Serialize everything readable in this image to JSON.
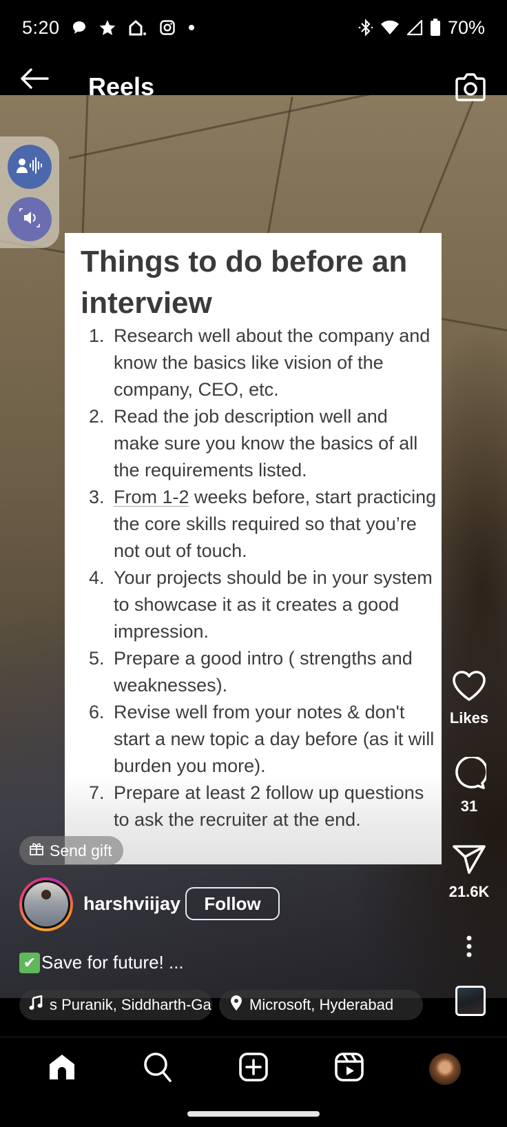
{
  "status_bar": {
    "time": "5:20",
    "left_icons": [
      "chat-bubble-icon",
      "star-icon",
      "home-alert-icon",
      "instagram-icon",
      "dot-icon"
    ],
    "right_icons": [
      "bluetooth-icon",
      "wifi-icon",
      "cell-signal-icon",
      "battery-icon"
    ],
    "battery": "70%"
  },
  "header": {
    "title": "Reels",
    "back_icon": "arrow-left-icon",
    "camera_icon": "camera-icon"
  },
  "accessibility_panel": {
    "buttons": [
      {
        "icon": "voice-access-icon"
      },
      {
        "icon": "sound-amplifier-icon"
      }
    ]
  },
  "reel_card": {
    "title": "Things to do before an interview",
    "items": [
      {
        "num": "1.",
        "text": "Research well about the company and know the basics like vision of the company, CEO, etc."
      },
      {
        "num": "2.",
        "text": "Read the job description well and make sure you know the basics of all the requirements listed."
      },
      {
        "num": "3.",
        "underlined": "From 1-2",
        "text": " weeks before, start practicing the core skills required so that you’re not out of touch."
      },
      {
        "num": "4.",
        "text": "Your projects should be in your system to showcase it as it creates a good impression."
      },
      {
        "num": "5.",
        "text": "Prepare a good intro ( strengths and weaknesses)."
      },
      {
        "num": "6.",
        "text": "Revise well from your notes & don't start a new topic a day before (as it will burden you more)."
      },
      {
        "num": "7.",
        "text": "Prepare at least 2 follow up questions to ask the recruiter at the end."
      }
    ]
  },
  "send_gift": {
    "label": "Send gift",
    "icon": "gift-icon"
  },
  "actions": {
    "like": {
      "icon": "heart-icon",
      "label": "Likes"
    },
    "comment": {
      "icon": "comment-icon",
      "count": "31"
    },
    "share": {
      "icon": "send-icon",
      "count": "21.6K"
    },
    "more": {
      "icon": "more-vertical-icon"
    }
  },
  "author": {
    "username": "harshviijay",
    "follow_label": "Follow"
  },
  "caption": {
    "emoji": "✔",
    "text": "Save for future! ..."
  },
  "music_chip": {
    "icon": "music-note-icon",
    "text": "s Puranik, Siddharth-Ga"
  },
  "location_chip": {
    "icon": "location-pin-icon",
    "text": "Microsoft, Hyderabad"
  },
  "bottom_nav": {
    "items": [
      {
        "name": "home",
        "icon": "home-icon",
        "active": true
      },
      {
        "name": "search",
        "icon": "search-icon"
      },
      {
        "name": "create",
        "icon": "add-square-icon"
      },
      {
        "name": "reels",
        "icon": "reels-icon"
      },
      {
        "name": "profile",
        "icon": "profile-avatar"
      }
    ]
  },
  "colors": {
    "accessibility_primary": "#4b68ad",
    "accessibility_secondary": "#6a6eb0",
    "card_text": "#3a3a3a",
    "caption_check": "#5fb85a"
  }
}
